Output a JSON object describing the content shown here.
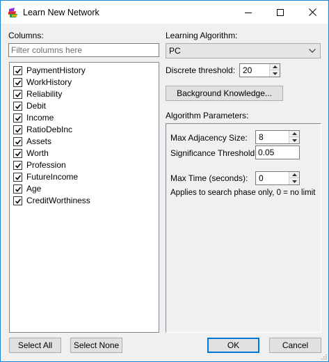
{
  "window": {
    "title": "Learn New Network",
    "minimize_icon": "minimize-icon",
    "maximize_icon": "maximize-icon",
    "close_icon": "close-icon"
  },
  "columns": {
    "label": "Columns:",
    "filter_placeholder": "Filter columns here",
    "items": [
      {
        "label": "PaymentHistory",
        "checked": true
      },
      {
        "label": "WorkHistory",
        "checked": true
      },
      {
        "label": "Reliability",
        "checked": true
      },
      {
        "label": "Debit",
        "checked": true
      },
      {
        "label": "Income",
        "checked": true
      },
      {
        "label": "RatioDebInc",
        "checked": true
      },
      {
        "label": "Assets",
        "checked": true
      },
      {
        "label": "Worth",
        "checked": true
      },
      {
        "label": "Profession",
        "checked": true
      },
      {
        "label": "FutureIncome",
        "checked": true
      },
      {
        "label": "Age",
        "checked": true
      },
      {
        "label": "CreditWorthiness",
        "checked": true
      }
    ]
  },
  "algorithm": {
    "label": "Learning Algorithm:",
    "selected": "PC",
    "discrete_threshold_label": "Discrete threshold:",
    "discrete_threshold_value": "20",
    "background_knowledge_label": "Background Knowledge...",
    "parameters_label": "Algorithm Parameters:",
    "max_adjacency_label": "Max Adjacency Size:",
    "max_adjacency_value": "8",
    "significance_label": "Significance Threshold:",
    "significance_value": "0.05",
    "max_time_label": "Max Time (seconds):",
    "max_time_value": "0",
    "note": "Applies to search phase only, 0 = no limit"
  },
  "buttons": {
    "select_all": "Select All",
    "select_none": "Select None",
    "ok": "OK",
    "cancel": "Cancel"
  },
  "colors": {
    "accent": "#0078d7",
    "window_border": "#1883d7",
    "background": "#f0f0f0"
  }
}
